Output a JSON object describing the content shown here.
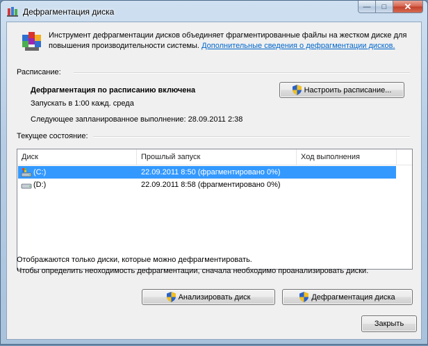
{
  "window": {
    "title": "Дефрагментация диска",
    "controls": {
      "minimize": "—",
      "maximize": "□",
      "close": "✕"
    }
  },
  "intro": {
    "text": "Инструмент дефрагментации дисков объединяет фрагментированные файлы на жестком диске для повышения производительности системы.",
    "link": "Дополнительные сведения о дефрагментации дисков."
  },
  "schedule": {
    "group_label": "Расписание:",
    "status": "Дефрагментация по расписанию включена",
    "run_at": "Запускать в 1:00 кажд. среда",
    "next_run": "Следующее запланированное выполнение: 28.09.2011 2:38",
    "configure_button": "Настроить расписание..."
  },
  "current": {
    "group_label": "Текущее состояние:",
    "columns": [
      "Диск",
      "Прошлый запуск",
      "Ход выполнения"
    ],
    "rows": [
      {
        "disk": "(C:)",
        "last_run": "22.09.2011 8:50 (фрагментировано 0%)",
        "progress": "",
        "selected": true,
        "icon": "system-drive-icon"
      },
      {
        "disk": "(D:)",
        "last_run": "22.09.2011 8:58 (фрагментировано 0%)",
        "progress": "",
        "selected": false,
        "icon": "hard-drive-icon"
      }
    ]
  },
  "notes": {
    "line1": "Отображаются только диски, которые можно дефрагментировать.",
    "line2": "Чтобы определить неоходимость  дефрагментации, сначала необходимо проанализировать диски."
  },
  "actions": {
    "analyze": "Анализировать диск",
    "defragment": "Дефрагментация диска",
    "close": "Закрыть"
  },
  "colors": {
    "selection": "#3399ff",
    "link": "#0066cc",
    "frame": "#b7cde4"
  }
}
